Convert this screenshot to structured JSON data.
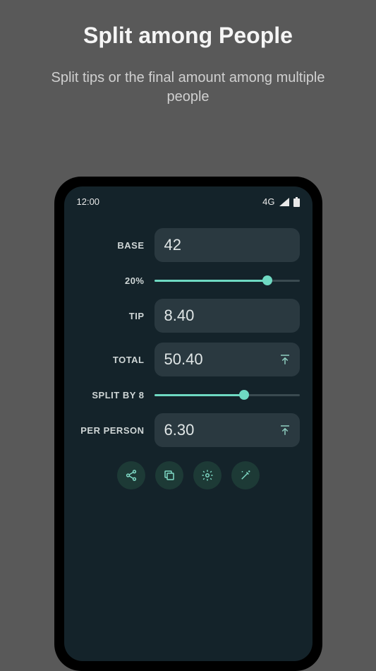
{
  "heading": "Split among People",
  "subheading": "Split tips or the final amount among multiple people",
  "statusbar": {
    "time": "12:00",
    "network": "4G"
  },
  "rows": {
    "base": {
      "label": "BASE",
      "value": "42"
    },
    "tipPercent": {
      "label": "20%",
      "percent": 78
    },
    "tip": {
      "label": "TIP",
      "value": "8.40"
    },
    "total": {
      "label": "TOTAL",
      "value": "50.40"
    },
    "split": {
      "label": "SPLIT BY 8",
      "percent": 62
    },
    "perPerson": {
      "label": "PER PERSON",
      "value": "6.30"
    }
  },
  "icons": {
    "share": "share-icon",
    "copy": "copy-icon",
    "settings": "gear-icon",
    "magic": "wand-icon"
  }
}
